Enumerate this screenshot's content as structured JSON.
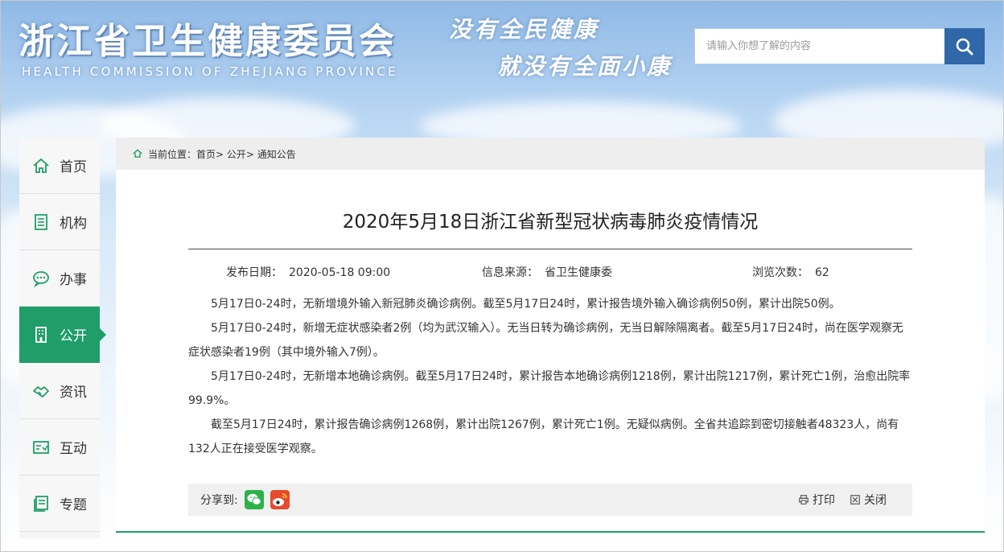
{
  "header": {
    "title": "浙江省卫生健康委员会",
    "subtitle": "HEALTH COMMISSION OF ZHEJIANG PROVINCE",
    "slogan_line1": "没有全民健康",
    "slogan_line2": "就没有全面小康"
  },
  "search": {
    "placeholder": "请输入你想了解的内容",
    "button_icon": "search-icon"
  },
  "sidebar": {
    "items": [
      {
        "label": "首页",
        "icon": "home-icon"
      },
      {
        "label": "机构",
        "icon": "building-list-icon"
      },
      {
        "label": "办事",
        "icon": "chat-bubble-icon"
      },
      {
        "label": "公开",
        "icon": "office-building-icon",
        "active": true
      },
      {
        "label": "资讯",
        "icon": "handshake-icon"
      },
      {
        "label": "互动",
        "icon": "interaction-icon"
      },
      {
        "label": "专题",
        "icon": "topic-icon"
      }
    ]
  },
  "breadcrumb": {
    "text": "当前位置：首页> 公开> 通知公告"
  },
  "article": {
    "title": "2020年5月18日浙江省新型冠状病毒肺炎疫情情况",
    "meta": {
      "date_label": "发布日期：",
      "date_value": "2020-05-18 09:00",
      "source_label": "信息来源：",
      "source_value": "省卫生健康委",
      "views_label": "浏览次数：",
      "views_value": "62"
    },
    "paragraphs": [
      "5月17日0-24时，无新增境外输入新冠肺炎确诊病例。截至5月17日24时，累计报告境外输入确诊病例50例，累计出院50例。",
      "5月17日0-24时，新增无症状感染者2例（均为武汉输入）。无当日转为确诊病例，无当日解除隔离者。截至5月17日24时，尚在医学观察无症状感染者19例（其中境外输入7例）。",
      "5月17日0-24时，无新增本地确诊病例。截至5月17日24时，累计报告本地确诊病例1218例，累计出院1217例，累计死亡1例，治愈出院率99.9%。",
      "截至5月17日24时，累计报告确诊病例1268例，累计出院1267例，累计死亡1例。无疑似病例。全省共追踪到密切接触者48323人，尚有132人正在接受医学观察。"
    ]
  },
  "share": {
    "label": "分享到:",
    "print_label": "打印",
    "close_label": "关闭"
  },
  "colors": {
    "accent_green": "#1f9e6a",
    "search_blue": "#2f67a8"
  }
}
